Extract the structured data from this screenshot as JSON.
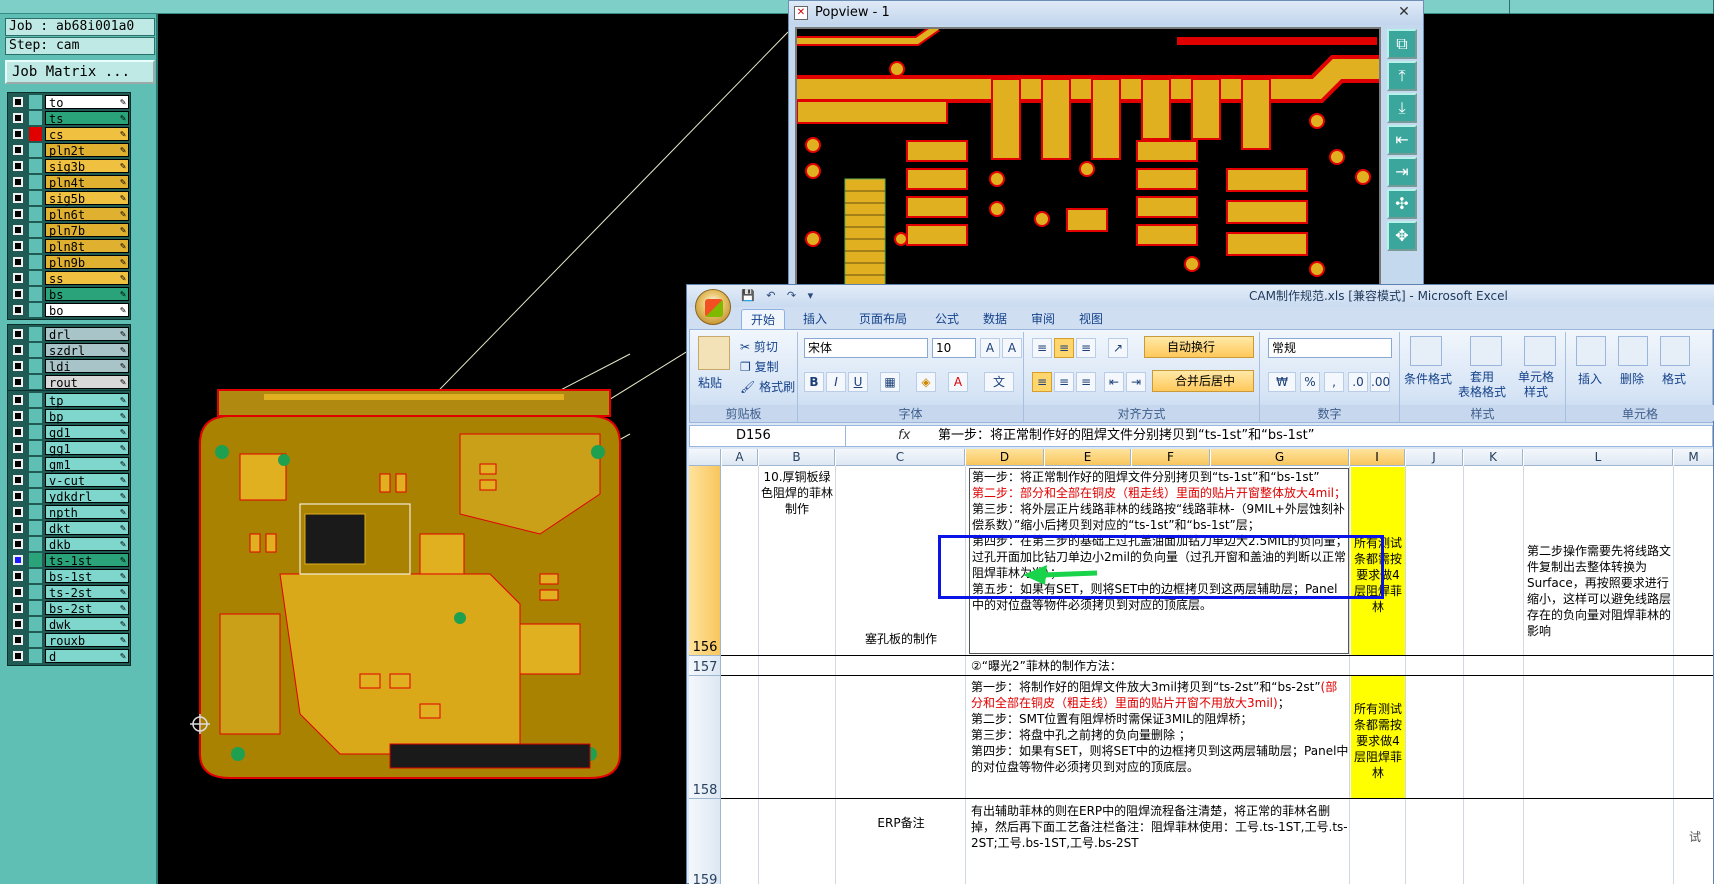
{
  "cam": {
    "job_label": "Job : ab68i001a0",
    "step_label": "Step: cam",
    "job_matrix_button": "Job Matrix ...",
    "layer_groups": [
      [
        {
          "name": "to",
          "color": "#ffffff",
          "mark": "#5fbfb5"
        },
        {
          "name": "ts",
          "color": "#2aa37a",
          "mark": "#5fbfb5"
        },
        {
          "name": "cs",
          "color": "#f0c040",
          "mark": "#e00000"
        },
        {
          "name": "pln2t",
          "color": "#e0b030",
          "mark": "#5fbfb5"
        },
        {
          "name": "sig3b",
          "color": "#f0c040",
          "mark": "#5fbfb5"
        },
        {
          "name": "pln4t",
          "color": "#e0b030",
          "mark": "#5fbfb5"
        },
        {
          "name": "sig5b",
          "color": "#f0c040",
          "mark": "#5fbfb5"
        },
        {
          "name": "pln6t",
          "color": "#e0b030",
          "mark": "#5fbfb5"
        },
        {
          "name": "pln7b",
          "color": "#e0b030",
          "mark": "#5fbfb5"
        },
        {
          "name": "pln8t",
          "color": "#e0b030",
          "mark": "#5fbfb5"
        },
        {
          "name": "pln9b",
          "color": "#e0b030",
          "mark": "#5fbfb5"
        },
        {
          "name": "ss",
          "color": "#f0c040",
          "mark": "#5fbfb5"
        },
        {
          "name": "bs",
          "color": "#2aa37a",
          "mark": "#5fbfb5"
        },
        {
          "name": "bo",
          "color": "#ffffff",
          "mark": "#5fbfb5"
        }
      ],
      [
        {
          "name": "drl",
          "color": "#a9c4c8",
          "mark": "#5fbfb5"
        },
        {
          "name": "szdrl",
          "color": "#a9c4c8",
          "mark": "#5fbfb5"
        },
        {
          "name": "ldi",
          "color": "#a9c4c8",
          "mark": "#5fbfb5"
        },
        {
          "name": "rout",
          "color": "#d8d8d8",
          "mark": "#5fbfb5"
        }
      ],
      [
        {
          "name": "tp",
          "color": "#7fd6cc",
          "mark": "#5fbfb5"
        },
        {
          "name": "bp",
          "color": "#7fd6cc",
          "mark": "#5fbfb5"
        },
        {
          "name": "gd1",
          "color": "#7fd6cc",
          "mark": "#5fbfb5"
        },
        {
          "name": "gg1",
          "color": "#7fd6cc",
          "mark": "#5fbfb5"
        },
        {
          "name": "gm1",
          "color": "#7fd6cc",
          "mark": "#5fbfb5"
        },
        {
          "name": "v-cut",
          "color": "#7fd6cc",
          "mark": "#5fbfb5"
        },
        {
          "name": "ydkdrl",
          "color": "#7fd6cc",
          "mark": "#5fbfb5"
        },
        {
          "name": "npth",
          "color": "#7fd6cc",
          "mark": "#5fbfb5"
        },
        {
          "name": "dkt",
          "color": "#7fd6cc",
          "mark": "#5fbfb5"
        },
        {
          "name": "dkb",
          "color": "#7fd6cc",
          "mark": "#5fbfb5"
        },
        {
          "name": "ts-1st",
          "color": "#2aa37a",
          "mark": "#2aa37a",
          "active": true
        },
        {
          "name": "bs-1st",
          "color": "#7fd6cc",
          "mark": "#5fbfb5"
        },
        {
          "name": "ts-2st",
          "color": "#7fd6cc",
          "mark": "#5fbfb5"
        },
        {
          "name": "bs-2st",
          "color": "#7fd6cc",
          "mark": "#5fbfb5"
        },
        {
          "name": "dwk",
          "color": "#7fd6cc",
          "mark": "#5fbfb5"
        },
        {
          "name": "rouxb",
          "color": "#7fd6cc",
          "mark": "#5fbfb5"
        },
        {
          "name": "d",
          "color": "#7fd6cc",
          "mark": "#5fbfb5"
        }
      ]
    ]
  },
  "popview": {
    "title": "Popview - 1",
    "tools": [
      "fit-icon",
      "zoom-in-icon",
      "zoom-out-icon",
      "pan-left-icon",
      "pan-right-icon",
      "zoom-fit-icon",
      "pan-icon"
    ]
  },
  "excel": {
    "title": "CAM制作规范.xls  [兼容模式] - Microsoft Excel",
    "tabs": [
      "开始",
      "插入",
      "页面布局",
      "公式",
      "数据",
      "审阅",
      "视图"
    ],
    "ribbon": {
      "paste": "粘贴",
      "cut": "剪切",
      "copy": "复制",
      "format_painter": "格式刷",
      "clipboard_label": "剪贴板",
      "font_name": "宋体",
      "font_size": "10",
      "bold": "B",
      "italic": "I",
      "underline": "U",
      "font_label": "字体",
      "wrap_text": "自动换行",
      "merge_center": "合并后居中",
      "align_label": "对齐方式",
      "number_format": "常规",
      "percent": "%",
      "comma": ",",
      "number_label": "数字",
      "cond_format": "条件格式",
      "table_format": "套用\n表格格式",
      "cell_style": "单元格\n样式",
      "styles_label": "样式",
      "insert": "插入",
      "delete": "删除",
      "format": "格式",
      "cells_label": "单元格"
    },
    "name_box": "D156",
    "formula": "第一步：将正常制作好的阻焊文件分别拷贝到“ts-1st”和“bs-1st”",
    "columns": [
      "A",
      "B",
      "C",
      "D",
      "E",
      "F",
      "G",
      "I",
      "J",
      "K",
      "L",
      "M"
    ],
    "rows": [
      "156",
      "157",
      "158",
      "159"
    ],
    "cells": {
      "b156": "10.厚铜板绿色阻焊的菲林制作",
      "c156": "塞孔板的制作",
      "d156_1": "第一步：将正常制作好的阻焊文件分别拷贝到“ts-1st”和“bs-1st”",
      "d156_2": "第二步：部分和全部在铜皮（粗走线）里面的贴片开窗整体放大4mil；",
      "d156_3": "第三步：将外层正片线路菲林的线路按“线路菲林-（9MIL+外层蚀刻补偿系数）”缩小后拷贝到对应的“ts-1st”和“bs-1st”层；",
      "d156_4": "第四步：在第三步的基础上过孔盖油面加钻刀单边大2.5MIL的负向量；过孔开面加比钻刀单边小2mil的负向量（过孔开窗和盖油的判断以正常阻焊菲林为准）；",
      "d156_5": "第五步：如果有SET，则将SET中的边框拷贝到这两层辅助层；Panel中的对位盘等物件必须拷贝到对应的顶底层。",
      "i156": "所有测试条都需按要求做4层阻焊菲林",
      "l156": "第二步操作需要先将线路文件复制出去整体转换为Surface，再按照要求进行缩小，这样可以避免线路层存在的负向量对阻焊菲林的影响",
      "d157": "②“曝光2”菲林的制作方法：",
      "d158_1": "第一步：将制作好的阻焊文件放大3mil拷贝到“ts-2st”和“bs-2st”",
      "d158_1r": "(部分和全部在铜皮（粗走线）里面的贴片开窗不用放大3mil)",
      "d158_1e": "；",
      "d158_2": "第二步：SMT位置有阻焊桥时需保证3MIL的阻焊桥；",
      "d158_3": "第三步：将盘中孔之前拷的负向量删除 ；",
      "d158_4": "第四步：如果有SET，则将SET中的边框拷贝到这两层辅助层；Panel中的对位盘等物件必须拷贝到对应的顶底层。",
      "i158": "所有测试条都需按要求做4层阻焊菲林",
      "c159": "ERP备注",
      "d159": "有出辅助菲林的则在ERP中的阻焊流程备注清楚，将正常的菲林名删掉，然后再下面工艺备注栏备注：阻焊菲林使用：工号.ts-1ST,工号.ts-2ST;工号.bs-1ST,工号.bs-2ST",
      "side_note": "试"
    }
  }
}
